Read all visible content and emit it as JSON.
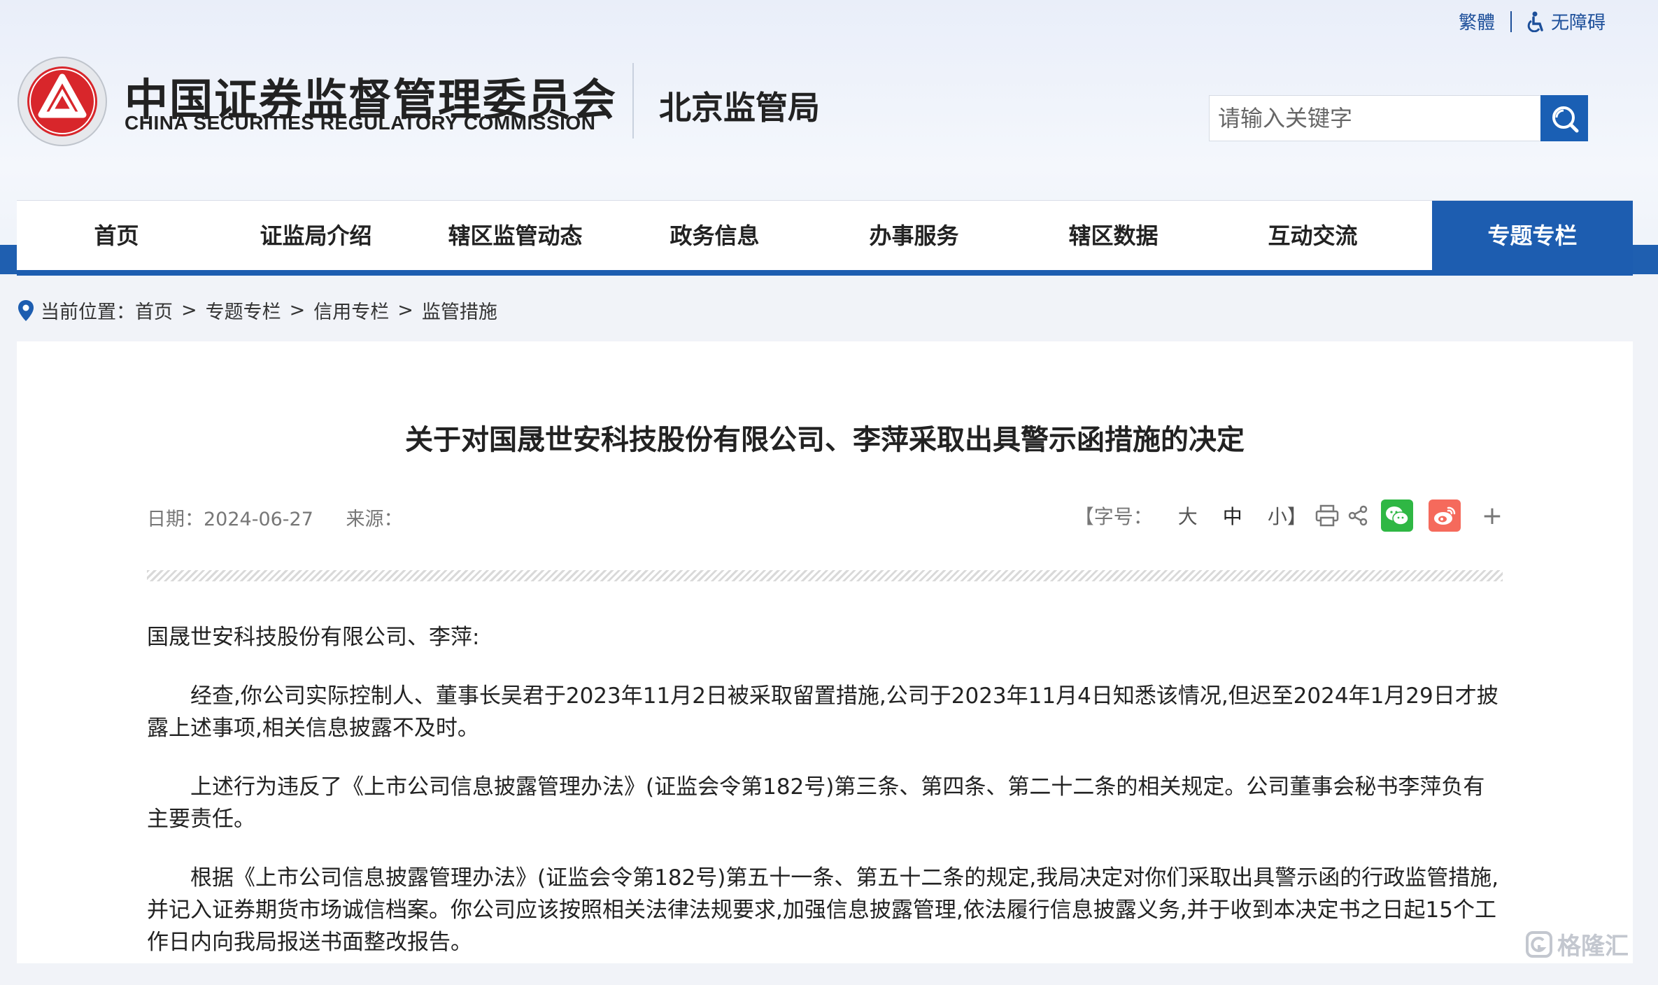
{
  "utility": {
    "traditional": "繁體",
    "accessibility": "无障碍"
  },
  "header": {
    "org_cn": "中国证券监督管理委员会",
    "org_en": "CHINA SECURITIES REGULATORY COMMISSION",
    "bureau": "北京监管局"
  },
  "search": {
    "placeholder": "请输入关键字"
  },
  "nav": [
    {
      "label": "首页"
    },
    {
      "label": "证监局介绍"
    },
    {
      "label": "辖区监管动态"
    },
    {
      "label": "政务信息"
    },
    {
      "label": "办事服务"
    },
    {
      "label": "辖区数据"
    },
    {
      "label": "互动交流"
    },
    {
      "label": "专题专栏",
      "active": true
    }
  ],
  "breadcrumb": {
    "prefix": "当前位置：",
    "items": [
      "首页",
      "专题专栏",
      "信用专栏",
      "监管措施"
    ],
    "separator": ">"
  },
  "article": {
    "title": "关于对国晟世安科技股份有限公司、李萍采取出具警示函措施的决定",
    "date_label": "日期：",
    "date": "2024-06-27",
    "source_label": "来源：",
    "font_size_label": "【字号：",
    "font_large": "大",
    "font_medium": "中",
    "font_small": "小】",
    "more": "+",
    "paragraphs": [
      "国晟世安科技股份有限公司、李萍:",
      "经查,你公司实际控制人、董事长吴君于2023年11月2日被采取留置措施,公司于2023年11月4日知悉该情况,但迟至2024年1月29日才披露上述事项,相关信息披露不及时。",
      "上述行为违反了《上市公司信息披露管理办法》(证监会令第182号)第三条、第四条、第二十二条的相关规定。公司董事会秘书李萍负有主要责任。",
      "根据《上市公司信息披露管理办法》(证监会令第182号)第五十一条、第五十二条的规定,我局决定对你们采取出具警示函的行政监管措施,并记入证券期货市场诚信档案。你公司应该按照相关法律法规要求,加强信息披露管理,依法履行信息披露义务,并于收到本决定书之日起15个工作日内向我局报送书面整改报告。"
    ]
  },
  "watermark": "格隆汇",
  "colors": {
    "brand_blue": "#1d5db0",
    "emblem_red": "#d8262b",
    "wechat_green": "#2fb744",
    "weibo_red": "#f56a5c"
  }
}
